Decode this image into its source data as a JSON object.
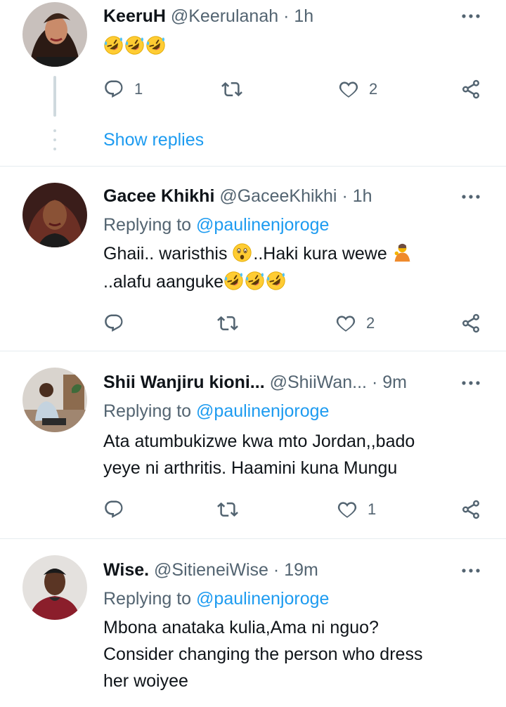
{
  "tweets": [
    {
      "name": "KeeruH",
      "handle": "@Keerulanah",
      "sep": "·",
      "time": "1h",
      "replying_label": "",
      "replying_to": "",
      "lines": [
        ""
      ],
      "emoji_count": 3,
      "reply_count": "1",
      "like_count": "2",
      "show_replies": "Show replies"
    },
    {
      "name": "Gacee Khikhi",
      "handle": "@GaceeKhikhi",
      "sep": "·",
      "time": "1h",
      "replying_label": "Replying to",
      "replying_to": "@paulinenjoroge",
      "line1_a": "Ghaii.. waristhis",
      "line1_b": "..Haki kura wewe",
      "line2": "..alafu aanguke",
      "reply_count": "",
      "like_count": "2"
    },
    {
      "name": "Shii Wanjiru kioni...",
      "handle": "@ShiiWan...",
      "sep": "·",
      "time": "9m",
      "replying_label": "Replying to",
      "replying_to": "@paulinenjoroge",
      "line1": "Ata atumbukizwe kwa mto Jordan,,bado",
      "line2": "yeye ni arthritis.  Haamini kuna Mungu",
      "reply_count": "",
      "like_count": "1"
    },
    {
      "name": "Wise.",
      "handle": "@SitieneiWise",
      "sep": "·",
      "time": "19m",
      "replying_label": "Replying to",
      "replying_to": "@paulinenjoroge",
      "line1": "Mbona anataka kulia,Ama ni nguo?",
      "line2": "Consider changing the person who dress",
      "line3": "her woiyee"
    }
  ],
  "colors": {
    "accent": "#1d9bf0",
    "muted": "#536471",
    "text": "#0f1419",
    "divider": "#e6ecf0"
  }
}
